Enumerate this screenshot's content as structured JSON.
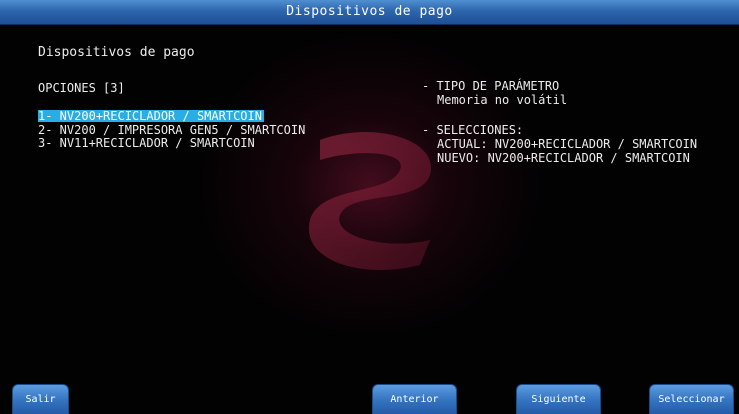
{
  "window": {
    "title": "Dispositivos de pago"
  },
  "main": {
    "heading": "Dispositivos de pago",
    "options_label": "OPCIONES [3]",
    "options": [
      {
        "label": "1- NV200+RECICLADOR / SMARTCOIN",
        "selected": true
      },
      {
        "label": "2- NV200 / IMPRESORA GEN5 / SMARTCOIN",
        "selected": false
      },
      {
        "label": "3- NV11+RECICLADOR / SMARTCOIN",
        "selected": false
      }
    ]
  },
  "info": {
    "param_type_label": "- TIPO DE PARÁMETRO",
    "param_type_value": "Memoria no volátil",
    "selections_label": "- SELECCIONES:",
    "current": "ACTUAL: NV200+RECICLADOR / SMARTCOIN",
    "new": "NUEVO: NV200+RECICLADOR / SMARTCOIN"
  },
  "buttons": {
    "exit": "Salir",
    "previous": "Anterior",
    "next": "Siguiente",
    "select": "Seleccionar"
  },
  "colors": {
    "titlebar": "#2d66ad",
    "selection_highlight": "#28aee4",
    "button": "#3575c2",
    "background": "#030203"
  }
}
